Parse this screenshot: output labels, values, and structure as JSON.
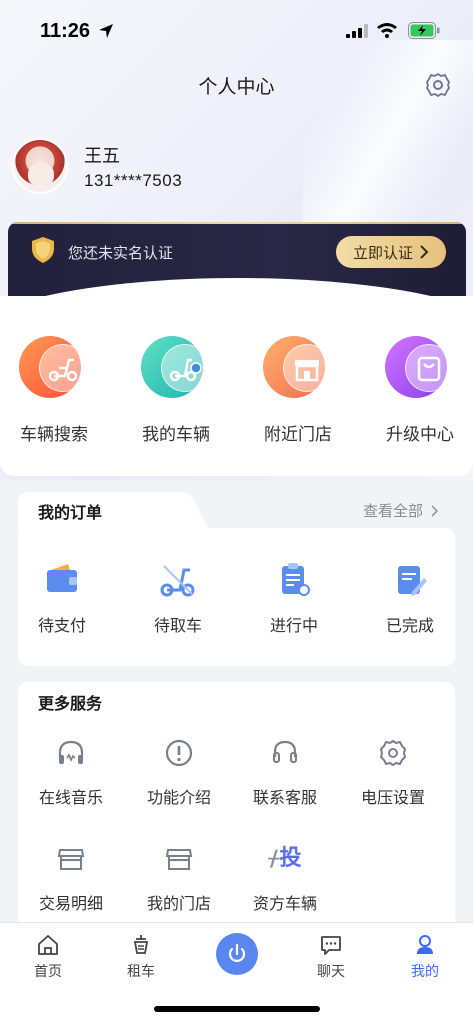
{
  "status_bar": {
    "time": "11:26"
  },
  "header": {
    "title": "个人中心"
  },
  "user": {
    "name": "王五",
    "phone": "131****7503"
  },
  "verify": {
    "text": "您还未实名认证",
    "button": "立即认证"
  },
  "quick_actions": [
    {
      "label": "车辆搜索",
      "icon": "scooter-search-icon",
      "color": "#ff6a3d"
    },
    {
      "label": "我的车辆",
      "icon": "my-scooter-icon",
      "color": "#2cc6b5"
    },
    {
      "label": "附近门店",
      "icon": "store-icon",
      "color": "#ff8a4c"
    },
    {
      "label": "升级中心",
      "icon": "upgrade-bag-icon",
      "color": "#a35cf4"
    }
  ],
  "orders": {
    "title": "我的订单",
    "view_all": "查看全部",
    "items": [
      {
        "label": "待支付",
        "icon": "wallet-icon"
      },
      {
        "label": "待取车",
        "icon": "scooter-pickup-icon"
      },
      {
        "label": "进行中",
        "icon": "clipboard-progress-icon"
      },
      {
        "label": "已完成",
        "icon": "document-done-icon"
      }
    ]
  },
  "services": {
    "title": "更多服务",
    "items": [
      {
        "label": "在线音乐",
        "icon": "headphones-icon"
      },
      {
        "label": "功能介绍",
        "icon": "info-icon"
      },
      {
        "label": "联系客服",
        "icon": "support-headset-icon"
      },
      {
        "label": "电压设置",
        "icon": "gear-icon"
      },
      {
        "label": "交易明细",
        "icon": "transaction-store-icon"
      },
      {
        "label": "我的门店",
        "icon": "my-store-icon"
      },
      {
        "label": "资方车辆",
        "icon": "investor-vehicle-icon"
      }
    ],
    "investor_glyph": "投"
  },
  "tabbar": [
    {
      "label": "首页",
      "icon": "home-icon"
    },
    {
      "label": "租车",
      "icon": "rent-icon"
    },
    {
      "label": "",
      "icon": "power-icon"
    },
    {
      "label": "聊天",
      "icon": "chat-icon"
    },
    {
      "label": "我的",
      "icon": "profile-icon",
      "active": true
    }
  ],
  "colors": {
    "accent": "#3b6bf6",
    "gold": "#e6c27c",
    "banner_dark": "#22203a"
  }
}
